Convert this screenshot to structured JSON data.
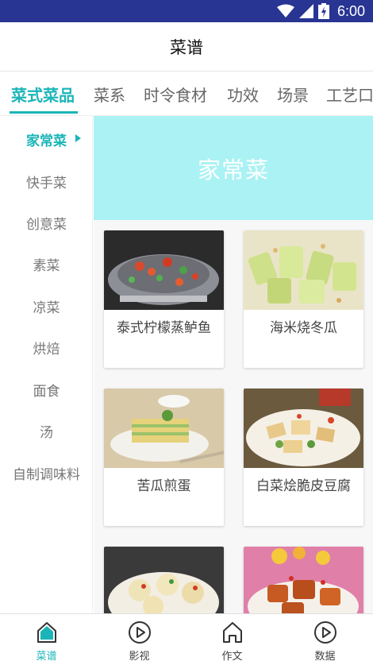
{
  "status": {
    "time": "6:00"
  },
  "header": {
    "title": "菜谱"
  },
  "tabs": [
    {
      "label": "菜式菜品"
    },
    {
      "label": "菜系"
    },
    {
      "label": "时令食材"
    },
    {
      "label": "功效"
    },
    {
      "label": "场景"
    },
    {
      "label": "工艺口"
    }
  ],
  "sidebar": {
    "items": [
      {
        "label": "家常菜"
      },
      {
        "label": "快手菜"
      },
      {
        "label": "创意菜"
      },
      {
        "label": "素菜"
      },
      {
        "label": "凉菜"
      },
      {
        "label": "烘焙"
      },
      {
        "label": "面食"
      },
      {
        "label": "汤"
      },
      {
        "label": "自制调味料"
      }
    ]
  },
  "banner": {
    "title": "家常菜"
  },
  "recipes": [
    {
      "title": "泰式柠檬蒸鲈鱼"
    },
    {
      "title": "海米烧冬瓜"
    },
    {
      "title": "苦瓜煎蛋"
    },
    {
      "title": "白菜烩脆皮豆腐"
    },
    {
      "title": ""
    },
    {
      "title": ""
    }
  ],
  "bottom_nav": [
    {
      "label": "菜谱",
      "icon": "home-icon"
    },
    {
      "label": "影视",
      "icon": "play-icon"
    },
    {
      "label": "作文",
      "icon": "house-icon"
    },
    {
      "label": "数据",
      "icon": "play-icon"
    }
  ],
  "colors": {
    "accent": "#1bb5b8",
    "statusbar": "#283593",
    "banner": "#aaf2f4"
  }
}
